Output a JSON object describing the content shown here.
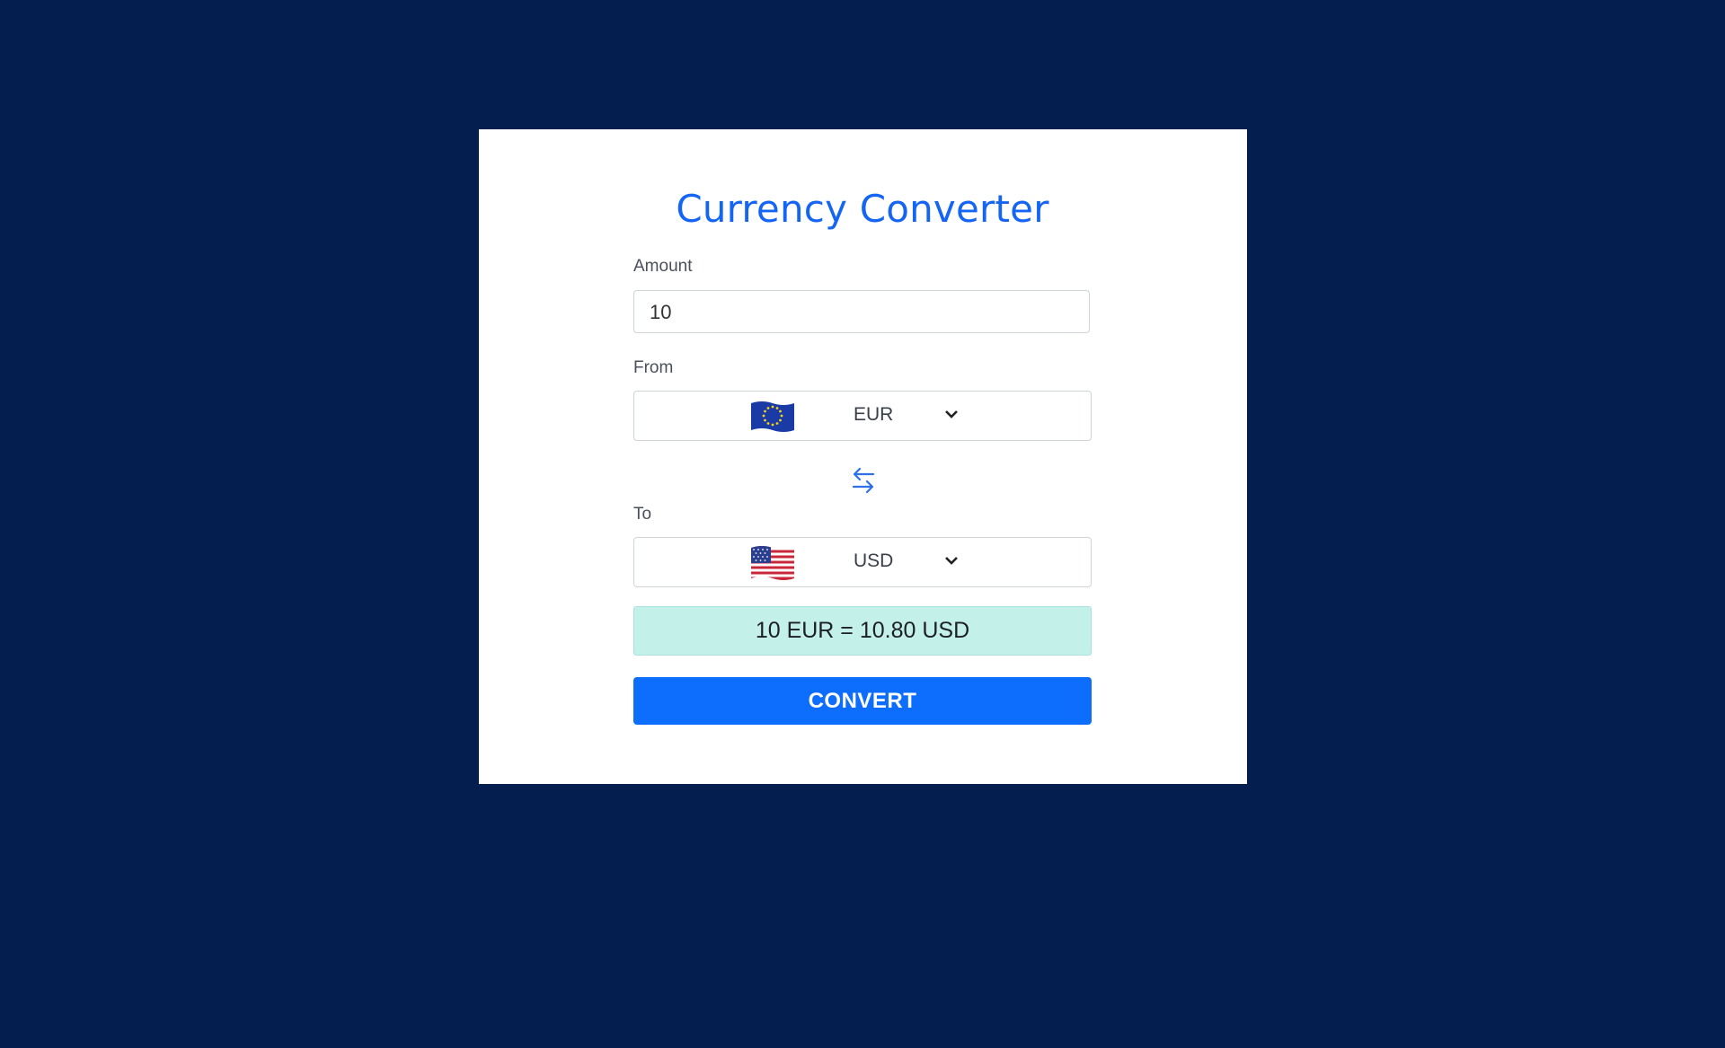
{
  "title": "Currency Converter",
  "amount": {
    "label": "Amount",
    "value": "10"
  },
  "from": {
    "label": "From",
    "currency": "EUR",
    "flag_icon": "eu-flag-icon"
  },
  "to": {
    "label": "To",
    "currency": "USD",
    "flag_icon": "us-flag-icon"
  },
  "result": "10 EUR = 10.80 USD",
  "convert_label": "CONVERT",
  "colors": {
    "background": "#041e50",
    "accent": "#0d6efd",
    "title": "#1565f4",
    "result_bg": "#c4f0ea"
  }
}
